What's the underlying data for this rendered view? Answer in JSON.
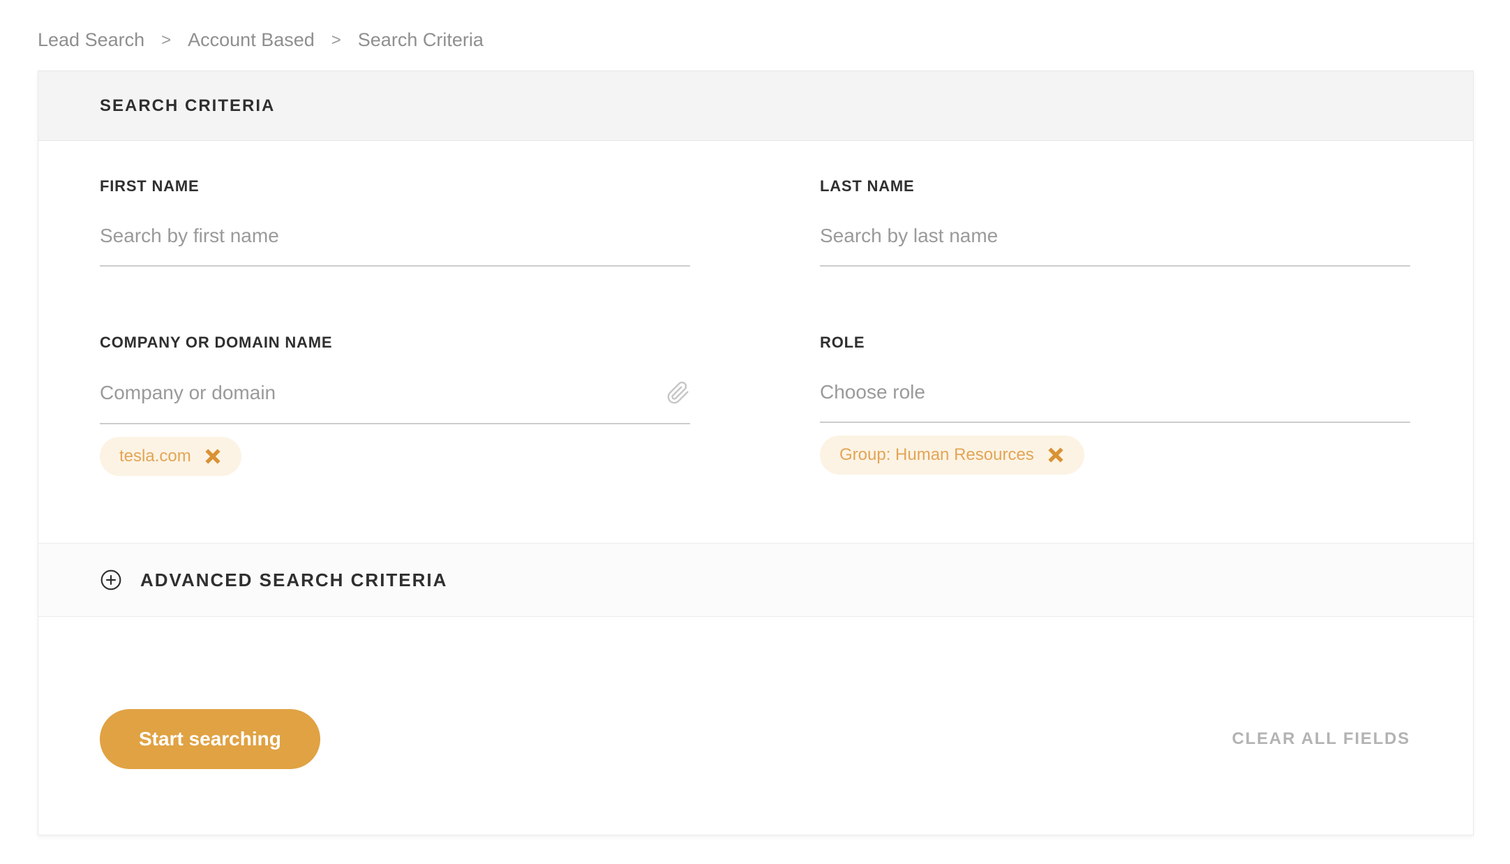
{
  "breadcrumb": {
    "separator": ">",
    "items": [
      {
        "label": "Lead Search"
      },
      {
        "label": "Account Based"
      },
      {
        "label": "Search Criteria"
      }
    ]
  },
  "panel": {
    "title": "SEARCH CRITERIA",
    "fields": {
      "first_name": {
        "label": "FIRST NAME",
        "placeholder": "Search by first name",
        "value": ""
      },
      "last_name": {
        "label": "LAST NAME",
        "placeholder": "Search by last name",
        "value": ""
      },
      "company": {
        "label": "COMPANY OR DOMAIN NAME",
        "placeholder": "Company or domain",
        "value": "",
        "icon": "paperclip-icon",
        "tags": [
          {
            "label": "tesla.com",
            "remove_icon": "close-icon"
          }
        ]
      },
      "role": {
        "label": "ROLE",
        "placeholder": "Choose role",
        "value": "",
        "tags": [
          {
            "label": "Group: Human Resources",
            "remove_icon": "close-icon"
          }
        ]
      }
    },
    "advanced": {
      "icon": "plus-circle-icon",
      "label": "ADVANCED SEARCH CRITERIA"
    },
    "footer": {
      "start_button": "Start searching",
      "clear_button": "CLEAR ALL FIELDS"
    }
  },
  "colors": {
    "accent_orange": "#e0a243",
    "tag_background": "#fcf3e4",
    "tag_text": "#e3a556",
    "tag_close": "#da9234",
    "header_background": "#f4f4f4",
    "advanced_background": "#fbfbfb",
    "underline": "#cccccc",
    "label_text": "#2f2f2f",
    "placeholder_text": "#9a9a9a",
    "breadcrumb_text": "#8f8f8f",
    "clear_text": "#b3b3b3"
  }
}
